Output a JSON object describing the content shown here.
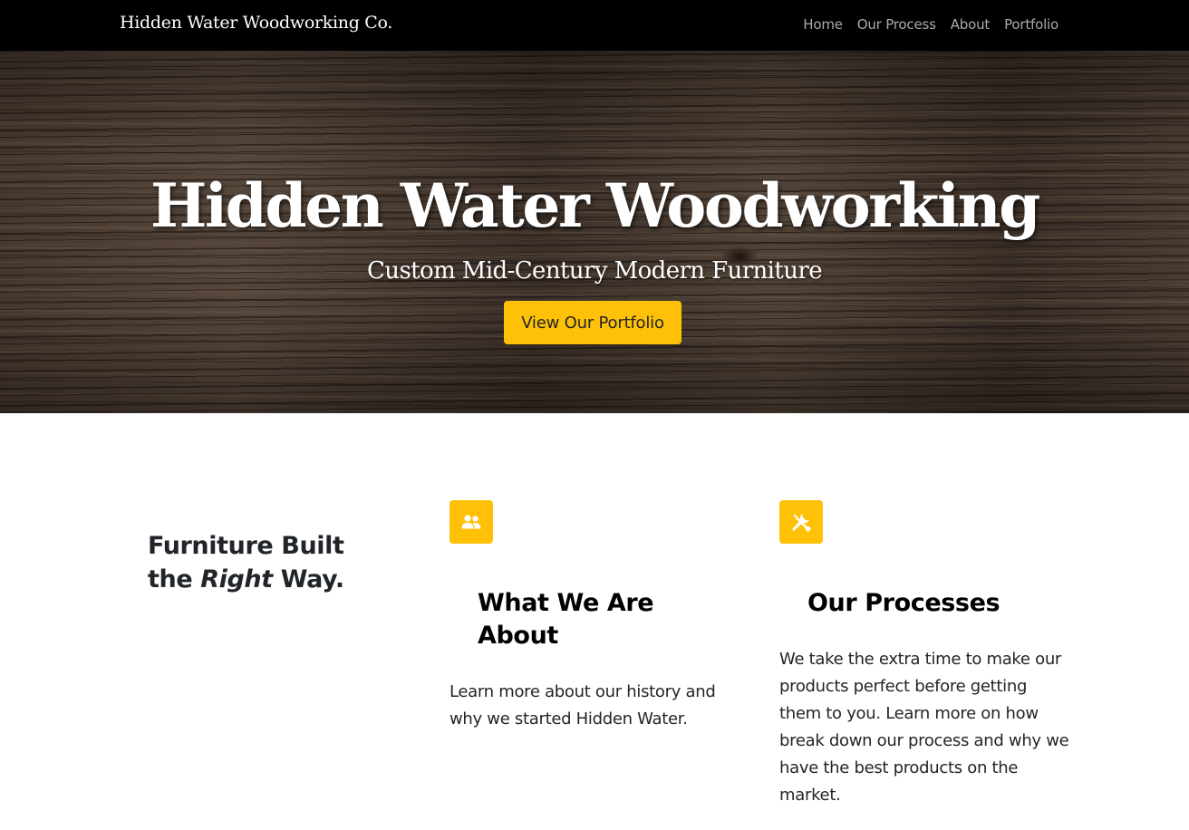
{
  "navbar": {
    "brand": "Hidden Water Woodworking Co.",
    "links": [
      "Home",
      "Our Process",
      "About",
      "Portfolio"
    ]
  },
  "hero": {
    "title": "Hidden Water Woodworking",
    "subtitle": "Custom Mid-Century Modern Furniture",
    "button_label": "View Our Portfolio"
  },
  "tagline": {
    "line1": "Furniture Built",
    "line2_prefix": "the ",
    "line2_emphasis": "Right",
    "line2_suffix": " Way."
  },
  "features": [
    {
      "icon": "people-icon",
      "title_line1": "What We Are",
      "title_line2": "About",
      "text": "Learn more about our history and why we started Hidden Water."
    },
    {
      "icon": "tools-icon",
      "title": "Our Processes",
      "text": "We take the extra time to make our products perfect before getting them to you. Learn more on how break down our process and why we have the best products on the market."
    }
  ],
  "colors": {
    "accent": "#ffc107",
    "navbar_bg": "#000000",
    "nav_link": "#a9a9a9"
  }
}
